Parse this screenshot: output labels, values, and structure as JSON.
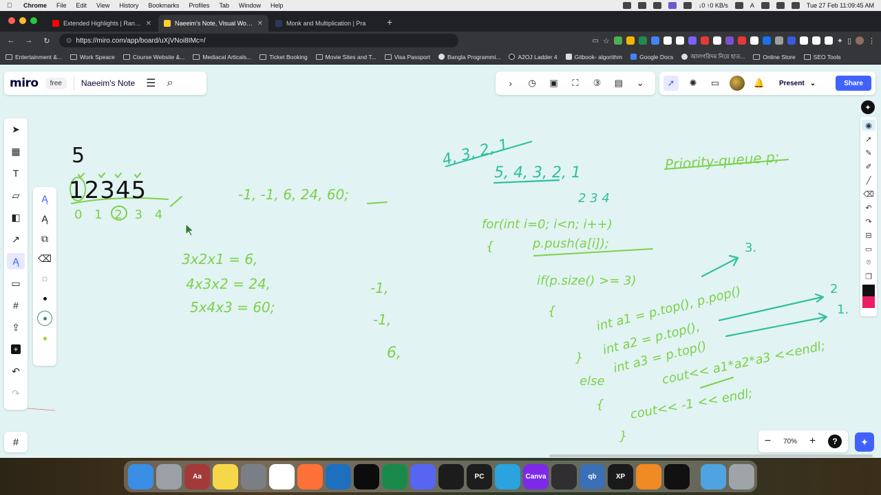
{
  "menubar": {
    "app": "Chrome",
    "items": [
      "File",
      "Edit",
      "View",
      "History",
      "Bookmarks",
      "Profiles",
      "Tab",
      "Window",
      "Help"
    ],
    "network": "↓0 ↑0 KB/s",
    "keyboard": "A",
    "datetime": "Tue 27 Feb  11:09:45 AM"
  },
  "browser": {
    "tabs": [
      {
        "title": "Extended Highlights | Rangpu",
        "favicon_color": "#ff0000"
      },
      {
        "title": "Naeeim's Note, Visual Works",
        "favicon_color": "#ffd02f"
      },
      {
        "title": "Monk and Multiplication | Pra",
        "favicon_color": "#2b3a55"
      }
    ],
    "new_tab": "+",
    "url": "https://miro.com/app/board/uXjVNoi8IMc=/",
    "bookmarks": [
      "Entertainment &...",
      "Work Speace",
      "Course Website &...",
      "Mediacal Articals...",
      "Ticket Booking",
      "Movie Sites and T...",
      "Visa Passport",
      "Bangla Programmi...",
      "A2OJ Ladder 4",
      "Gitbook- algorithm",
      "Google Docs",
      "আলগরিদম নিয়ে হাত...",
      "Online Store",
      "SEO Tools"
    ]
  },
  "miro": {
    "logo": "miro",
    "plan": "free",
    "board_name": "Naeeim's Note",
    "present_label": "Present",
    "share_label": "Share",
    "zoom": "70%",
    "help": "?"
  },
  "board": {
    "n_value": "5",
    "array_digits": "12345",
    "indices": "0 1 2 3 4",
    "result_list": "-1, -1, 6, 24, 60;",
    "products": [
      "3x2x1 = 6,",
      "4x3x2 = 24,",
      "5x4x3 = 60;"
    ],
    "column_values": [
      "-1,",
      "-1,",
      "6,"
    ],
    "reversed_top": "4, 3, 2, 1",
    "reversed_list": "5, 4, 3, 2, 1",
    "index_note": "2 3 4",
    "title_note": "Priority-queue p;",
    "code": [
      "for(int i=0; i<n; i++)",
      "{",
      "p.push(a[i]);",
      "if(p.size() >= 3)",
      "{",
      "int a1 = p.top(), p.pop()",
      "int a2 = p.top(),",
      "int a3 = p.top()",
      "cout<< a1*a2*a3 <<endl;",
      "}",
      "else",
      "{",
      "cout<< -1 << endl;",
      "}"
    ],
    "side_labels": [
      "3.",
      "2",
      "1."
    ],
    "ink_color": "#2fbf9e",
    "ink_green": "#7bd14a"
  },
  "dock": {
    "apps": [
      {
        "name": "Finder",
        "color": "#3a8ee6",
        "label": ""
      },
      {
        "name": "Launchpad",
        "color": "#9aa0a6",
        "label": ""
      },
      {
        "name": "Dictionary",
        "color": "#a33a3a",
        "label": "Aa"
      },
      {
        "name": "Notes",
        "color": "#f7d74a",
        "label": ""
      },
      {
        "name": "System Settings",
        "color": "#7a7f86",
        "label": ""
      },
      {
        "name": "Chrome",
        "color": "#ffffff",
        "label": ""
      },
      {
        "name": "Firefox",
        "color": "#ff7139",
        "label": ""
      },
      {
        "name": "VS Code",
        "color": "#1f6fbf",
        "label": ""
      },
      {
        "name": "Cursor",
        "color": "#0c0c0c",
        "label": ""
      },
      {
        "name": "Panda",
        "color": "#1a8a4a",
        "label": ""
      },
      {
        "name": "Discord",
        "color": "#5865f2",
        "label": ""
      },
      {
        "name": "Terminal",
        "color": "#1c1c1c",
        "label": ""
      },
      {
        "name": "PyCharm",
        "color": "#1d1d1d",
        "label": "PC"
      },
      {
        "name": "Telegram",
        "color": "#2aa3df",
        "label": ""
      },
      {
        "name": "Canva",
        "color": "#7d2ae8",
        "label": "Canva"
      },
      {
        "name": "OBS",
        "color": "#302e31",
        "label": ""
      },
      {
        "name": "qBittorrent",
        "color": "#3b6fb6",
        "label": "qb"
      },
      {
        "name": "XPPen",
        "color": "#1a1a1a",
        "label": "XP"
      },
      {
        "name": "VLC",
        "color": "#f08a24",
        "label": ""
      },
      {
        "name": "Miro Pen",
        "color": "#111111",
        "label": ""
      },
      {
        "name": "Downloads",
        "color": "#4fa3e0",
        "label": ""
      },
      {
        "name": "Trash",
        "color": "#9ea4a8",
        "label": ""
      }
    ]
  }
}
